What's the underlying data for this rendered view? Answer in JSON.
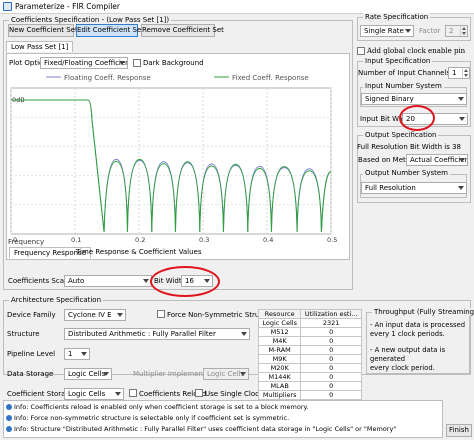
{
  "window": {
    "title": "Parameterize - FIR Compiler"
  },
  "coeff_spec": {
    "group_title": "Coefficients Specification - (Low Pass Set [1])",
    "buttons": [
      "New Coefficient Set",
      "Edit Coefficient Set",
      "Remove Coefficient Set"
    ],
    "tab": "Low Pass Set [1]",
    "plot_option_label": "Plot Option",
    "plot_option_value": "Fixed/Floating Coefficients",
    "dark_background_label": "Dark Background",
    "legend_floating": "Floating Coeff. Response",
    "legend_fixed": "Fixed Coeff. Response",
    "bottom_tabs": [
      "Frequency Response",
      "Time Response & Coefficient Values"
    ],
    "scaling_label": "Coefficients Scaling",
    "scaling_value": "Auto",
    "bit_width_label": "Bit Width",
    "bit_width_value": "16"
  },
  "chart_data": {
    "type": "line",
    "xlabel": "Frequency",
    "ylabel_top": "0dB",
    "x_ticks": [
      "0",
      "0.1",
      "0.2",
      "0.3",
      "0.4",
      "0.5"
    ],
    "xlim": [
      0,
      0.5
    ],
    "passband_edge": 0.125,
    "nulls": [
      0.147,
      0.182,
      0.22,
      0.257,
      0.295,
      0.332,
      0.37,
      0.407,
      0.447,
      0.485
    ],
    "grid": true,
    "series": [
      {
        "name": "Floating Coeff. Response",
        "color": "#7a80d6"
      },
      {
        "name": "Fixed Coeff. Response",
        "color": "#2ea03a"
      }
    ]
  },
  "rate_spec": {
    "title": "Rate Specification",
    "rate_value": "Single Rate",
    "factor_label": "Factor",
    "factor_value": "2"
  },
  "global_clock": {
    "label": "Add global clock enable pin"
  },
  "input_spec": {
    "title": "Input Specification",
    "channels_label": "Number of Input Channels",
    "channels_value": "1",
    "number_system_label": "Input Number System",
    "number_system_value": "Signed Binary",
    "bit_width_label": "Input Bit Width",
    "bit_width_value": "20"
  },
  "output_spec": {
    "title": "Output Specification",
    "full_res_text": "Full Resolution Bit Width is 38",
    "based_on_label": "Based on Method",
    "based_on_value": "Actual Coefficients",
    "number_system_label": "Output Number System",
    "number_system_value": "Full Resolution"
  },
  "arch_spec": {
    "title": "Architecture Specification",
    "device_family_label": "Device Family",
    "device_family_value": "Cyclone IV E",
    "force_symmetric_label": "Force Non-Symmetric Structure",
    "structure_label": "Structure",
    "structure_value": "Distributed Arithmetic : Fully Parallel Filter",
    "pipeline_label": "Pipeline Level",
    "pipeline_value": "1",
    "data_storage_label": "Data Storage",
    "data_storage_value": "Logic Cells",
    "mult_impl_label": "Multiplier Implementation",
    "mult_impl_value": "Logic Cells",
    "coeff_storage_label": "Coefficient Storage",
    "coeff_storage_value": "Logic Cells",
    "coeff_reload_label": "Coefficients Reload",
    "single_clock_label": "Use Single Clock"
  },
  "resource_table": {
    "headers": [
      "Resource",
      "Utilization esti..."
    ],
    "rows": [
      [
        "Logic Cells",
        "2321"
      ],
      [
        "M512",
        "0"
      ],
      [
        "M4K",
        "0"
      ],
      [
        "M-RAM",
        "0"
      ],
      [
        "M9K",
        "0"
      ],
      [
        "M20K",
        "0"
      ],
      [
        "M144K",
        "0"
      ],
      [
        "MLAB",
        "0"
      ],
      [
        "Multipliers",
        "0"
      ]
    ]
  },
  "throughput": {
    "title": "Throughput (Fully Streaming)",
    "lines": [
      "- An input data is processed",
      "every 1 clock periods.",
      "",
      "- A new output data is generated",
      "every clock period."
    ]
  },
  "info_messages": [
    "Info: Coefficients reload is enabled only when coefficient storage is set to a block memory.",
    "Info: Force non-symmetric structure is selectable only if coefficient set is symmetric.",
    "Info: Structure \"Distributed Arithmetic : Fully Parallel Filter\" uses coefficient data storage in \"Logic Cells\" or \"Memory\""
  ],
  "footer": {
    "finish_label": "Finish"
  }
}
